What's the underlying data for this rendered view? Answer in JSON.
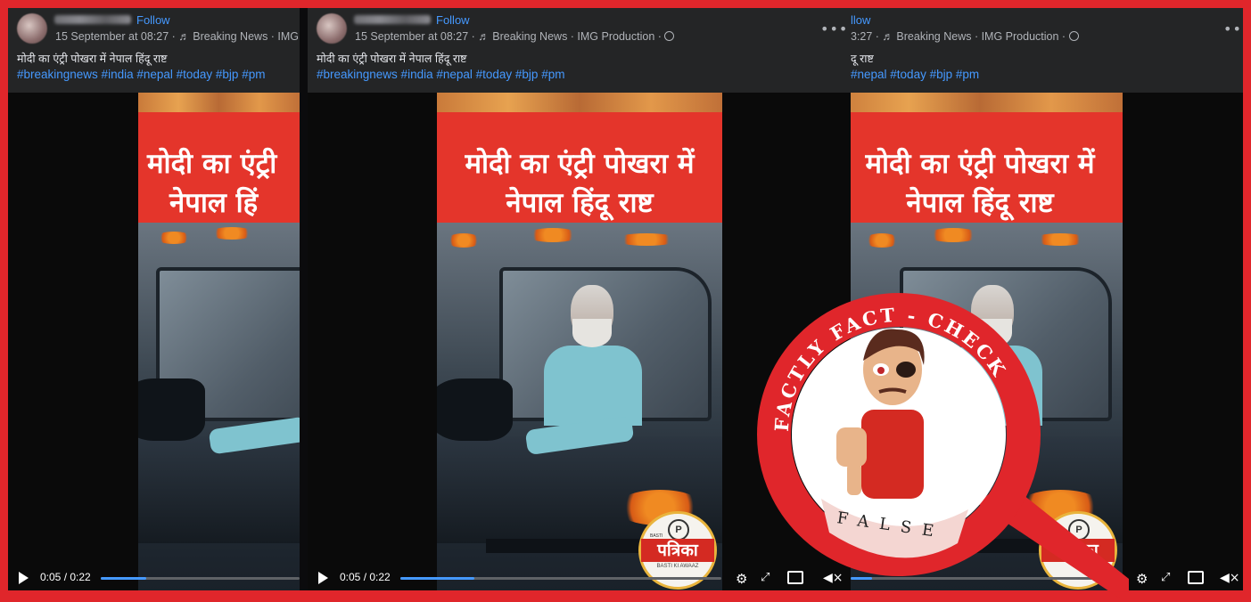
{
  "post": {
    "follow_label": "Follow",
    "meta": "15 September at 08:27 · ♬ Breaking News · IMG Production · ",
    "meta_left": "15 September at 08:27 · ♬ Breaking News · IMG",
    "meta_right": "3:27 · ♬ Breaking News · IMG Production · ",
    "follow_right": "llow",
    "caption": "मोदी का एंट्री पोखरा में नेपाल हिंदू राष्ट",
    "caption_right": "दू राष्ट",
    "hashtags": "#breakingnews #india #nepal #today #bjp #pm",
    "hashtags_right": "#nepal #today #bjp #pm",
    "more_label": "•••"
  },
  "video": {
    "banner_line1": "मोदी का एंट्री पोखरा में",
    "banner_line2": "नेपाल हिंदू राष्ट",
    "banner_line1_left": "मोदी का एंट्री",
    "banner_line2_left": "नेपाल हिं",
    "time": "0:05 / 0:22",
    "progress": 0.23
  },
  "logo": {
    "brand": "पत्रिका",
    "letter": "P",
    "tagline": "BASTI KI AWAAZ",
    "basti": "BASTI"
  },
  "stamp": {
    "ring_text": "FACTLY FACT - CHECK",
    "verdict": "FALSE",
    "colors": {
      "red": "#e0262b",
      "verdict_bg": "#f4d6d2"
    }
  },
  "icons": [
    "play-icon",
    "settings-icon",
    "fullscreen-icon",
    "pip-icon",
    "mute-icon",
    "more-icon",
    "globe-icon",
    "music-note-icon"
  ]
}
